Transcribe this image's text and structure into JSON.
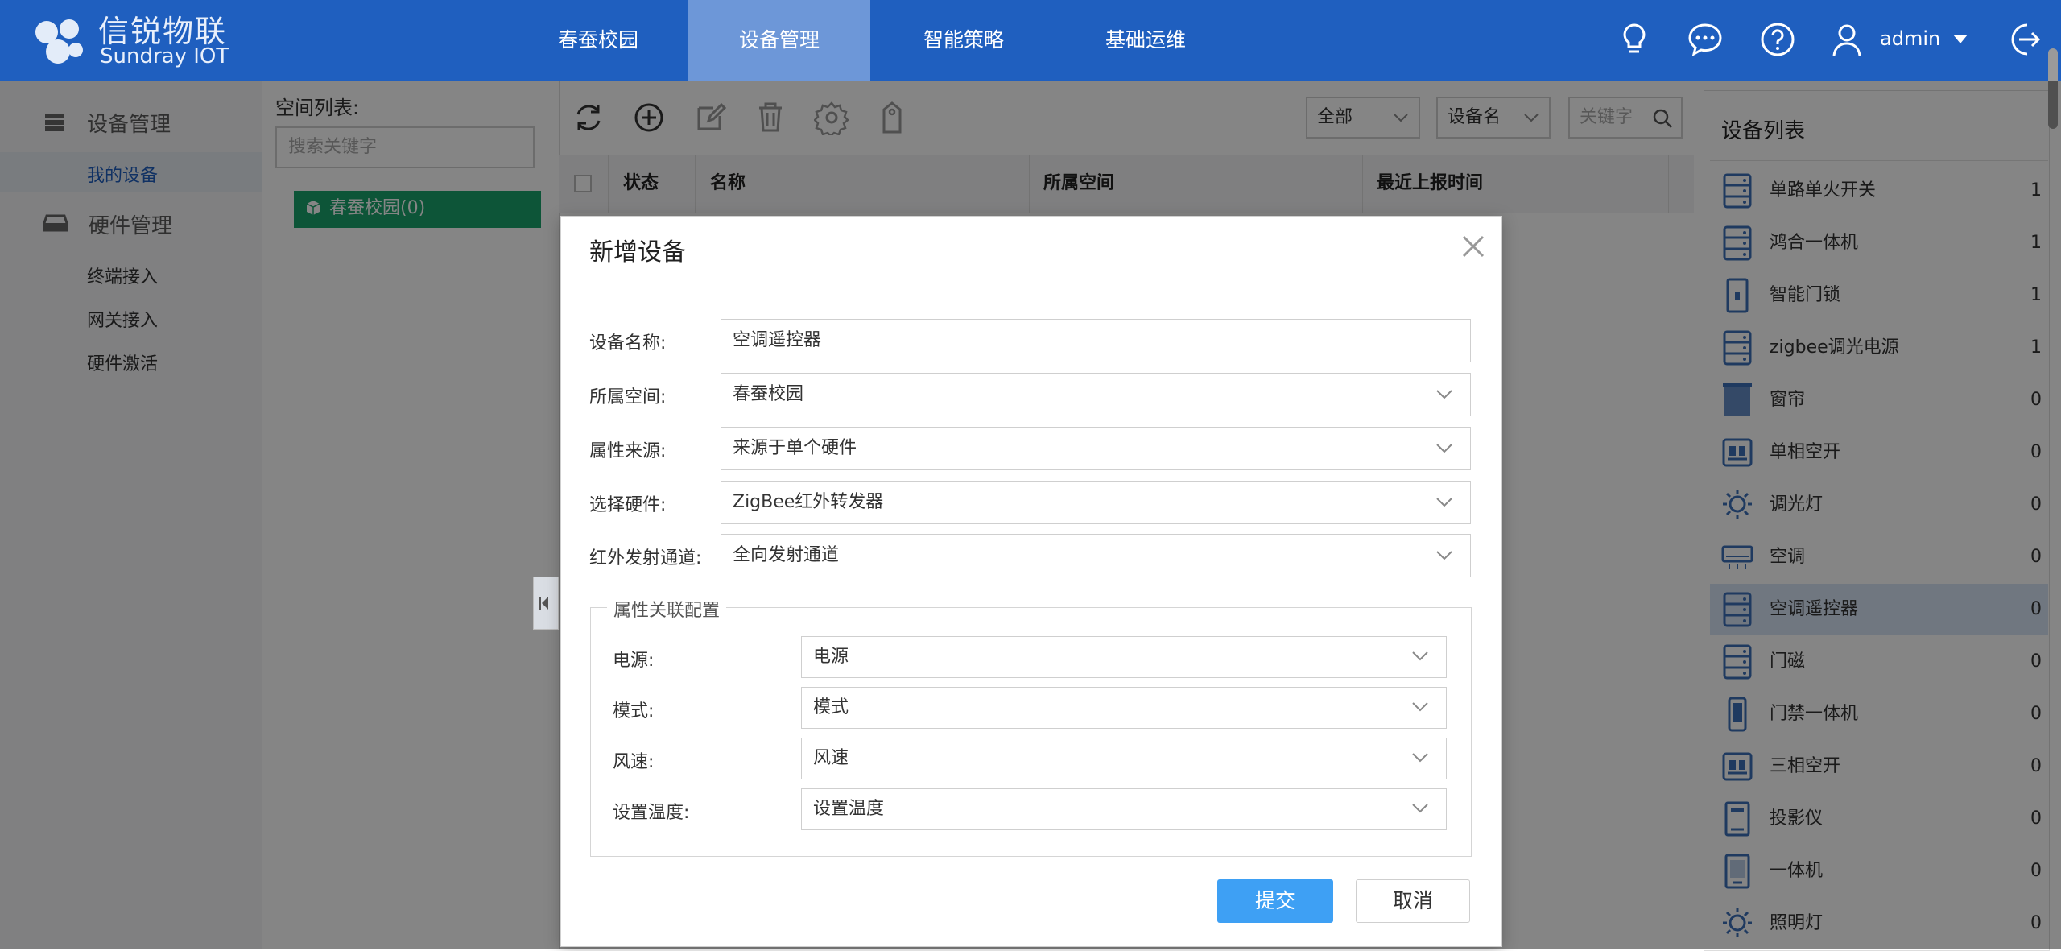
{
  "brand": {
    "name_cn": "信锐物联",
    "name_en": "Sundray IOT"
  },
  "nav": {
    "tabs": [
      {
        "label": "春蚕校园",
        "active": false
      },
      {
        "label": "设备管理",
        "active": true
      },
      {
        "label": "智能策略",
        "active": false
      },
      {
        "label": "基础运维",
        "active": false
      }
    ]
  },
  "header": {
    "user": "admin"
  },
  "leftnav": {
    "groups": [
      {
        "label": "设备管理",
        "icon": "list-icon",
        "items": [
          "我的设备"
        ]
      },
      {
        "label": "硬件管理",
        "icon": "hardware-icon",
        "items": [
          "终端接入",
          "网关接入",
          "硬件激活"
        ]
      }
    ],
    "selected_item": "我的设备"
  },
  "space_panel": {
    "title": "空间列表:",
    "search_placeholder": "搜索关键字",
    "tree_node": "春蚕校园(0)"
  },
  "toolbar": {
    "filter_scope": "全部",
    "filter_field": "设备名",
    "keyword_placeholder": "关键字"
  },
  "table": {
    "columns": [
      "状态",
      "名称",
      "所属空间",
      "最近上报时间"
    ]
  },
  "device_panel": {
    "title": "设备列表",
    "items": [
      {
        "name": "单路单火开关",
        "count": "1",
        "icon": "server-icon"
      },
      {
        "name": "鸿合一体机",
        "count": "1",
        "icon": "server-icon"
      },
      {
        "name": "智能门锁",
        "count": "1",
        "icon": "door-lock-icon"
      },
      {
        "name": "zigbee调光电源",
        "count": "1",
        "icon": "server-icon"
      },
      {
        "name": "窗帘",
        "count": "0",
        "icon": "curtain-icon"
      },
      {
        "name": "单相空开",
        "count": "0",
        "icon": "breaker-icon"
      },
      {
        "name": "调光灯",
        "count": "0",
        "icon": "bulb-icon"
      },
      {
        "name": "空调",
        "count": "0",
        "icon": "air-conditioner-icon"
      },
      {
        "name": "空调遥控器",
        "count": "0",
        "icon": "server-icon",
        "selected": true
      },
      {
        "name": "门磁",
        "count": "0",
        "icon": "server-icon"
      },
      {
        "name": "门禁一体机",
        "count": "0",
        "icon": "phone-icon"
      },
      {
        "name": "三相空开",
        "count": "0",
        "icon": "breaker-icon"
      },
      {
        "name": "投影仪",
        "count": "0",
        "icon": "projector-icon"
      },
      {
        "name": "一体机",
        "count": "0",
        "icon": "kiosk-icon"
      },
      {
        "name": "照明灯",
        "count": "0",
        "icon": "bulb-icon"
      }
    ]
  },
  "modal": {
    "title": "新增设备",
    "fields": [
      {
        "label": "设备名称:",
        "value": "空调遥控器",
        "type": "text"
      },
      {
        "label": "所属空间:",
        "value": "春蚕校园",
        "type": "select"
      },
      {
        "label": "属性来源:",
        "value": "来源于单个硬件",
        "type": "select"
      },
      {
        "label": "选择硬件:",
        "value": "ZigBee红外转发器",
        "type": "select"
      },
      {
        "label": "红外发射通道:",
        "value": "全向发射通道",
        "type": "select"
      }
    ],
    "fieldset": {
      "legend": "属性关联配置",
      "fields": [
        {
          "label": "电源:",
          "value": "电源"
        },
        {
          "label": "模式:",
          "value": "模式"
        },
        {
          "label": "风速:",
          "value": "风速"
        },
        {
          "label": "设置温度:",
          "value": "设置温度"
        }
      ]
    },
    "submit_label": "提交",
    "cancel_label": "取消"
  },
  "colors": {
    "header_bg": "#1f5fbf",
    "active_tab": "#6d97d8",
    "tree_green": "#1aa36b",
    "primary_button": "#3ea0f4",
    "selected_row": "#d6e4f5"
  }
}
